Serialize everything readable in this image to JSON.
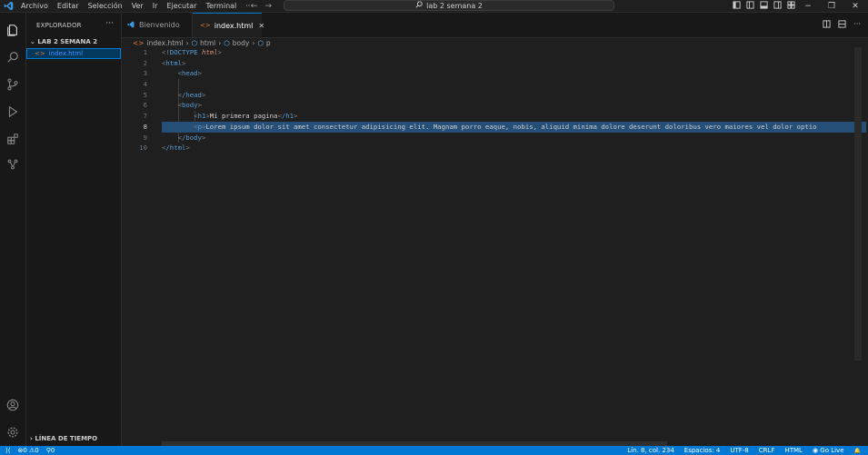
{
  "menu": [
    "Archivo",
    "Editar",
    "Selección",
    "Ver",
    "Ir",
    "Ejecutar",
    "Terminal",
    "···"
  ],
  "command_center": "lab 2 semana 2",
  "sidebar": {
    "title": "EXPLORADOR",
    "more": "···",
    "section": "LAB 2 SEMANA 2",
    "file": "index.html",
    "timeline": "LÍNEA DE TIEMPO"
  },
  "tabs": [
    {
      "label": "Bienvenido"
    },
    {
      "label": "index.html",
      "close": "✕"
    }
  ],
  "breadcrumb": [
    "index.html",
    "html",
    "body",
    "p"
  ],
  "editor": {
    "line_numbers": [
      "1",
      "2",
      "3",
      "4",
      "5",
      "6",
      "7",
      "8",
      "9",
      "10"
    ],
    "current_line": "8",
    "lines": {
      "l1_a": "<!",
      "l1_b": "DOCTYPE",
      "l1_c": " html",
      "l1_d": ">",
      "l2": "html",
      "l3": "head",
      "l5": "/head",
      "l6": "body",
      "l7_tag": "h1",
      "l7_text": "Mi primera pagina",
      "l7_end": "/h1",
      "l8_tag": "p",
      "l8_text": "Lorem ipsum dolor sit amet consectetur adipisicing elit. Magnam porro eaque, nobis, aliquid minima dolore deserunt doloribus vero maiores vel dolor optio",
      "l9": "/body",
      "l10": "/html"
    }
  },
  "status": {
    "remote": "⟩⟨",
    "problems": "⊗0 ⚠0",
    "ports": "0",
    "position": "Lín. 8, col. 234",
    "spaces": "Espacios: 4",
    "encoding": "UTF-8",
    "eol": "CRLF",
    "language": "HTML",
    "golive": "Go Live",
    "bell": "🔔"
  },
  "colors": {
    "accent": "#0078d4",
    "status_bg": "#0078d4",
    "editor_bg": "#1f1f1f",
    "selection": "#264f78"
  }
}
